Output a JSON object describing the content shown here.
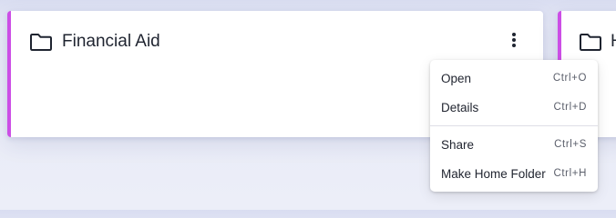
{
  "cards": [
    {
      "title": "Financial Aid",
      "icon": "folder-icon",
      "accent": "#cc4ee6"
    },
    {
      "title": "H",
      "icon": "folder-icon",
      "accent": "#cc4ee6"
    }
  ],
  "more_button": {
    "icon": "more-vertical-icon"
  },
  "context_menu": {
    "items": [
      {
        "label": "Open",
        "shortcut": "Ctrl+O"
      },
      {
        "label": "Details",
        "shortcut": "Ctrl+D"
      },
      {
        "label": "Share",
        "shortcut": "Ctrl+S"
      },
      {
        "label": "Make Home Folder",
        "shortcut": "Ctrl+H"
      }
    ]
  }
}
